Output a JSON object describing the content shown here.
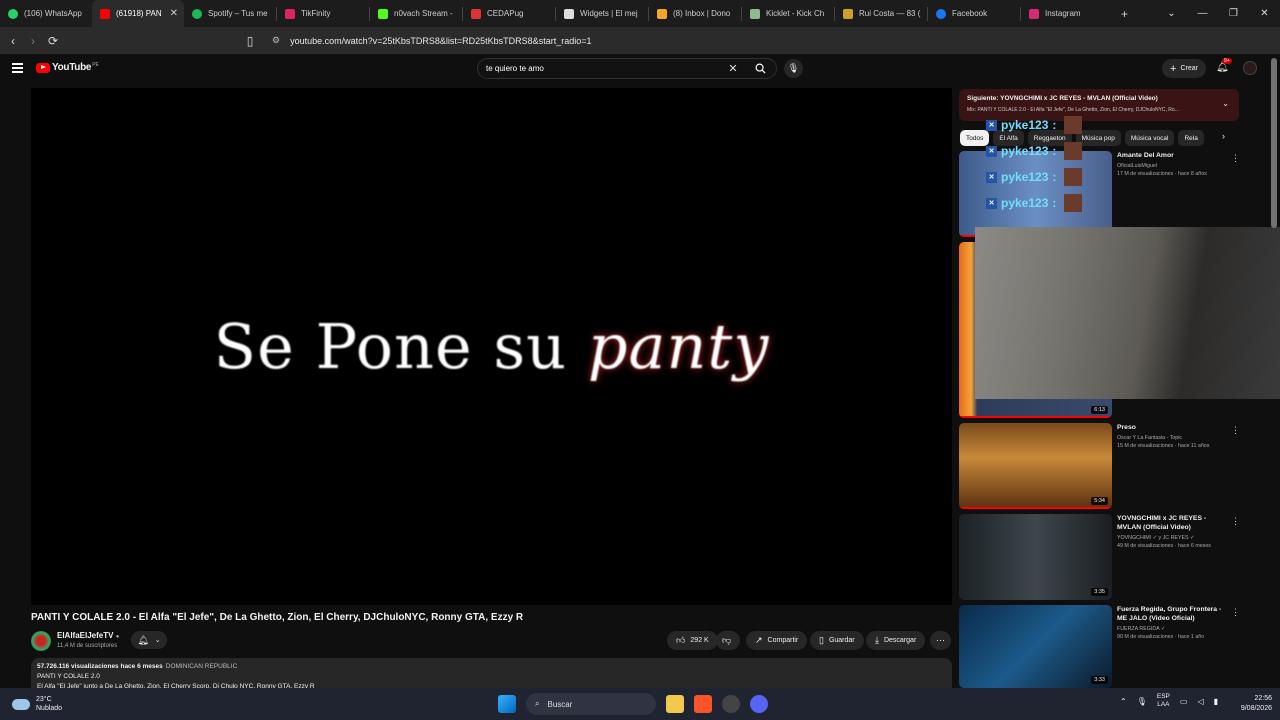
{
  "browser": {
    "tabs": [
      {
        "label": "(106) WhatsApp",
        "color": "#25d366"
      },
      {
        "label": "(61918) PAN",
        "color": "#ff0000",
        "active": true
      },
      {
        "label": "Spotify – Tus me",
        "color": "#1db954"
      },
      {
        "label": "TikFinity",
        "color": "#e0245e"
      },
      {
        "label": "n0vach Stream -",
        "color": "#53fc18"
      },
      {
        "label": "CEDAPug",
        "color": "#d33"
      },
      {
        "label": "Widgets | El mej",
        "color": "#ddd"
      },
      {
        "label": "(8) Inbox | Dono",
        "color": "#f5a623"
      },
      {
        "label": "Kicklet - Kick Ch",
        "color": "#8fbc8f"
      },
      {
        "label": "Rui Costa — 83 (",
        "color": "#c9a227"
      },
      {
        "label": "Facebook",
        "color": "#1877f2"
      },
      {
        "label": "Instagram",
        "color": "#d62976"
      }
    ],
    "new_tab": "+",
    "url": "youtube.com/watch?v=25tKbsTDRS8&list=RD25tKbsTDRS8&start_radio=1"
  },
  "youtube": {
    "logo_text": "YouTube",
    "logo_country": "PE",
    "search_value": "te quiero te amo",
    "create_label": "Crear",
    "notif_count": "9+"
  },
  "video": {
    "caption_plain": "Se Pone su",
    "caption_emph": "panty",
    "title": "PANTI Y COLALE 2.0 - El Alfa \"El Jefe\", De La Ghetto, Zion, El Cherry, DJChuloNYC, Ronny GTA, Ezzy R",
    "channel": "ElAlfaElJefeTV",
    "subscribers": "11,4 M de suscriptores",
    "likes": "292 K",
    "share": "Compartir",
    "save": "Guardar",
    "download": "Descargar",
    "views_line": "57.726.116 visualizaciones  hace 6 meses",
    "country": "DOMINICAN REPUBLIC",
    "desc_line2": "PANTI Y COLALE 2.0",
    "desc_line3": "El Alfa \"El Jefe\" junto a De La Ghetto, Zion, El Cherry Scorp, Dj Chulo NYC, Ronny GTA, Ezzy R"
  },
  "sidebar": {
    "next_title": "Siguiente: YOVNGCHIMI x JC REYES - MVLAN (Official Video)",
    "next_sub": "Mix: PANTI Y COLALE 2.0 - El Alfa \"El Jefe\", De La Ghetto, Zion, El Cherry, DJChuloNYC, Ro...",
    "chips": [
      "Todos",
      "El Alfa",
      "Reggaeton",
      "Música pop",
      "Música vocal",
      "Rela"
    ],
    "overlay_user": "pyke123",
    "recs": [
      {
        "title": "Amante Del Amor",
        "channel": "OficialLuisMiguel",
        "meta": "17 M de visualizaciones · hace 8 años",
        "duration": ""
      },
      {
        "title": "",
        "channel": "",
        "meta": "",
        "duration": "6:13"
      },
      {
        "title": "Preso",
        "channel": "Oscar Y La Fantasia - Topic",
        "meta": "15 M de visualizaciones · hace 11 años",
        "duration": "5:34"
      },
      {
        "title": "YOVNGCHIMI x JC REYES - MVLAN (Official Video)",
        "channel": "YOVNGCHIMI ✓ y JC REYES ✓",
        "meta": "49 M de visualizaciones · hace 6 meses",
        "duration": "3:35"
      },
      {
        "title": "Fuerza Regida, Grupo Frontera - ME JALO (Video Oficial)",
        "channel": "FUERZA REGIDA ✓",
        "meta": "90 M de visualizaciones · hace 1 año",
        "duration": "3:33"
      }
    ]
  },
  "taskbar": {
    "temp": "23°C",
    "weather": "Nublado",
    "search": "Buscar",
    "lang1": "ESP",
    "lang2": "LAA",
    "time": "22:56",
    "date": "9/08/2026"
  }
}
